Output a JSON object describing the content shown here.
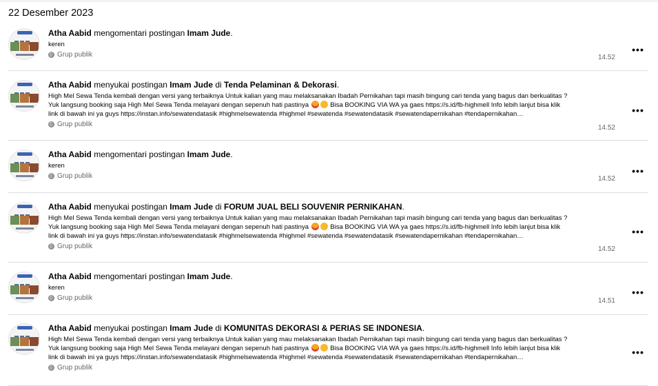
{
  "date_heading": "22 Desember 2023",
  "items": [
    {
      "actor": "Atha Aabid",
      "action": " mengomentari postingan ",
      "owner": "Imam Jude",
      "connector": "",
      "group": "",
      "end": ".",
      "text_lines": [
        "keren"
      ],
      "privacy": "Grup publik",
      "time": "14.52",
      "more": "•••"
    },
    {
      "actor": "Atha Aabid",
      "action": " menyukai postingan ",
      "owner": "Imam Jude",
      "connector": " di ",
      "group": "Tenda Pelaminan & Dekorasi",
      "end": ".",
      "text_lines": [
        "High Mel Sewa Tenda kembali dengan versi yang terbaiknya Untuk kalian yang mau melaksanakan Ibadah Pernikahan tapi masih bingung cari tenda yang bagus dan berkualitas ?",
        "Yuk langsung booking saja High Mel Sewa Tenda melayani dengan sepenuh hati pastinya",
        " Bisa BOOKING VIA WA ya gaes https://s.id/fb-highmell Info lebih lanjut bisa klik",
        "link di bawah ini ya guys https://instan.info/sewatendatasik #highmelsewatenda #highmel #sewatenda #sewatendatasik #sewatendapernikahan #tendapernikahan…"
      ],
      "privacy": "Grup publik",
      "time": "14.52",
      "more": "•••"
    },
    {
      "actor": "Atha Aabid",
      "action": " mengomentari postingan ",
      "owner": "Imam Jude",
      "connector": "",
      "group": "",
      "end": ".",
      "text_lines": [
        "keren"
      ],
      "privacy": "Grup publik",
      "time": "14.52",
      "more": "•••"
    },
    {
      "actor": "Atha Aabid",
      "action": " menyukai postingan ",
      "owner": "Imam Jude",
      "connector": " di ",
      "group": "FORUM JUAL BELI SOUVENIR PERNIKAHAN",
      "end": ".",
      "text_lines": [
        "High Mel Sewa Tenda kembali dengan versi yang terbaiknya Untuk kalian yang mau melaksanakan Ibadah Pernikahan tapi masih bingung cari tenda yang bagus dan berkualitas ?",
        "Yuk langsung booking saja High Mel Sewa Tenda melayani dengan sepenuh hati pastinya",
        " Bisa BOOKING VIA WA ya gaes https://s.id/fb-highmell Info lebih lanjut bisa klik",
        "link di bawah ini ya guys https://instan.info/sewatendatasik #highmelsewatenda #highmel #sewatenda #sewatendatasik #sewatendapernikahan #tendapernikahan…"
      ],
      "privacy": "Grup publik",
      "time": "14.52",
      "more": "•••"
    },
    {
      "actor": "Atha Aabid",
      "action": " mengomentari postingan ",
      "owner": "Imam Jude",
      "connector": "",
      "group": "",
      "end": ".",
      "text_lines": [
        "keren"
      ],
      "privacy": "Grup publik",
      "time": "14.51",
      "more": "•••"
    },
    {
      "actor": "Atha Aabid",
      "action": " menyukai postingan ",
      "owner": "Imam Jude",
      "connector": " di ",
      "group": "KOMUNITAS DEKORASI & PERIAS SE INDONESIA",
      "end": ".",
      "text_lines": [
        "High Mel Sewa Tenda kembali dengan versi yang terbaiknya Untuk kalian yang mau melaksanakan Ibadah Pernikahan tapi masih bingung cari tenda yang bagus dan berkualitas ?",
        "Yuk langsung booking saja High Mel Sewa Tenda melayani dengan sepenuh hati pastinya",
        " Bisa BOOKING VIA WA ya gaes https://s.id/fb-highmell Info lebih lanjut bisa klik",
        "link di bawah ini ya guys https://instan.info/sewatendatasik #highmelsewatenda #highmel #sewatenda #sewatendatasik #sewatendapernikahan #tendapernikahan…"
      ],
      "privacy": "Grup publik",
      "time": "",
      "more": "•••"
    }
  ]
}
